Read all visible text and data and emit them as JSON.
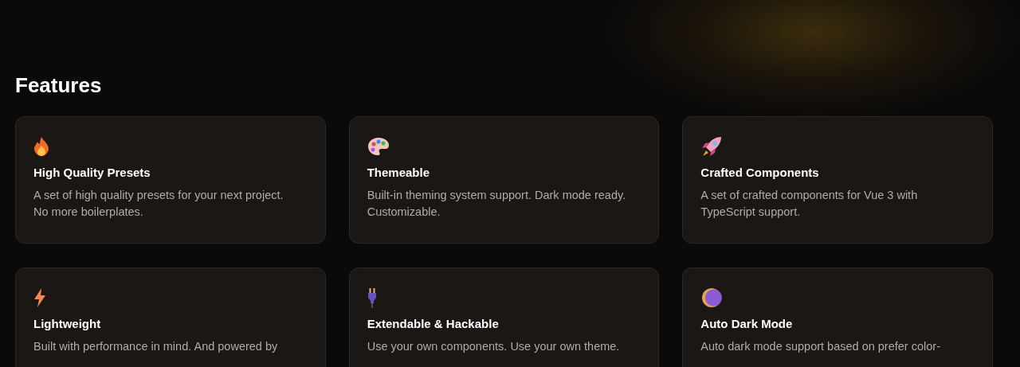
{
  "heading": "Features",
  "features": [
    {
      "kind": "flame",
      "title": "High Quality Presets",
      "description": "A set of high quality presets for your next project.\nNo more boilerplates."
    },
    {
      "kind": "palette",
      "title": "Themeable",
      "description": "Built-in theming system support. Dark mode ready.\nCustomizable."
    },
    {
      "kind": "rocket",
      "title": "Crafted Components",
      "description": "A set of crafted components for Vue 3 with\nTypeScript support."
    },
    {
      "kind": "bolt",
      "title": "Lightweight",
      "description": "Built with performance in mind. And powered by"
    },
    {
      "kind": "plug",
      "title": "Extendable & Hackable",
      "description": "Use your own components. Use your own theme."
    },
    {
      "kind": "moon",
      "title": "Auto Dark Mode",
      "description": "Auto dark mode support based on prefer color-"
    }
  ]
}
